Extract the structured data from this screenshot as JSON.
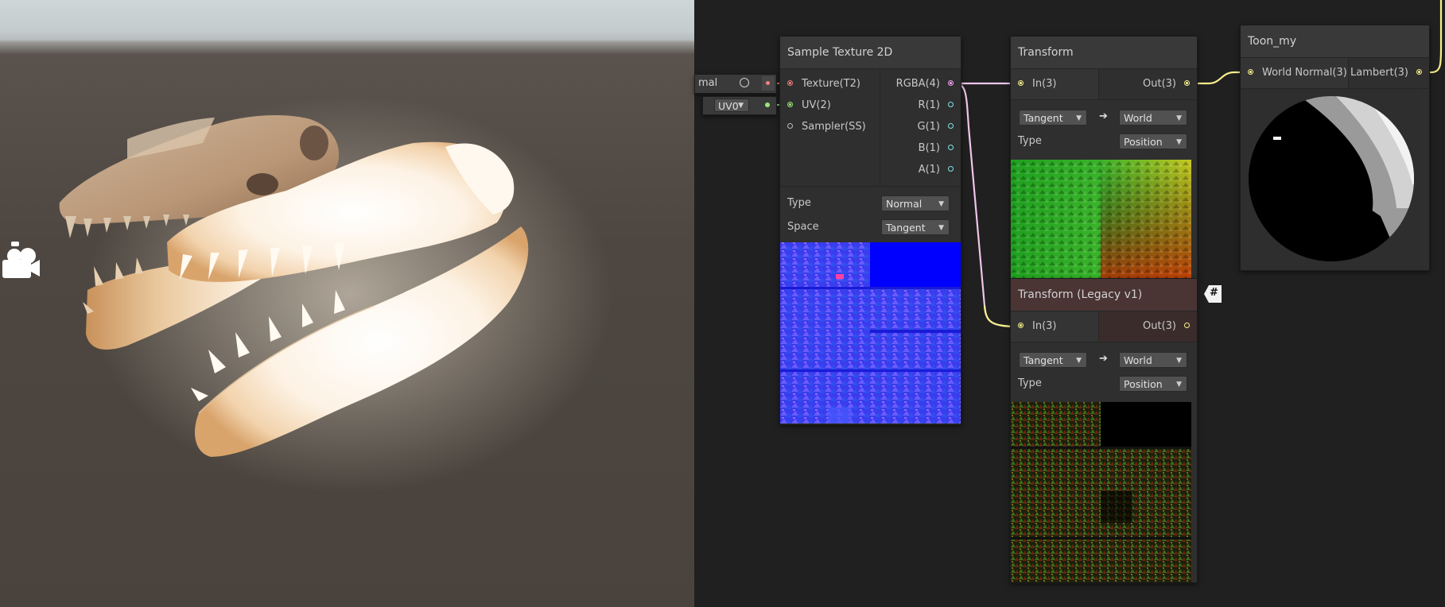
{
  "graph": {
    "left_node": {
      "property_label": "mal",
      "uv_value": "UV0"
    },
    "sample_texture": {
      "title": "Sample Texture 2D",
      "inputs": [
        "Texture(T2)",
        "UV(2)",
        "Sampler(SS)"
      ],
      "outputs": [
        "RGBA(4)",
        "R(1)",
        "G(1)",
        "B(1)",
        "A(1)"
      ],
      "type_label": "Type",
      "type_value": "Normal",
      "space_label": "Space",
      "space_value": "Tangent"
    },
    "transform": {
      "title": "Transform",
      "input": "In(3)",
      "output": "Out(3)",
      "from": "Tangent",
      "to": "World",
      "type_label": "Type",
      "type_value": "Position"
    },
    "transform_legacy": {
      "title": "Transform (Legacy v1)",
      "input": "In(3)",
      "output": "Out(3)",
      "from": "Tangent",
      "to": "World",
      "type_label": "Type",
      "type_value": "Position",
      "badge": "#"
    },
    "toon": {
      "title": "Toon_my",
      "input": "World Normal(3)",
      "output": "Lambert(3)"
    },
    "arrow_glyph": "➔"
  },
  "colors": {
    "texture_port": "#f08080",
    "uv_port": "#9be57a",
    "sampler_port": "#bbbbbb",
    "vector4_port": "#f1a0f0",
    "vector1_port": "#7fe3e5",
    "vector3_port": "#f7f08a"
  }
}
